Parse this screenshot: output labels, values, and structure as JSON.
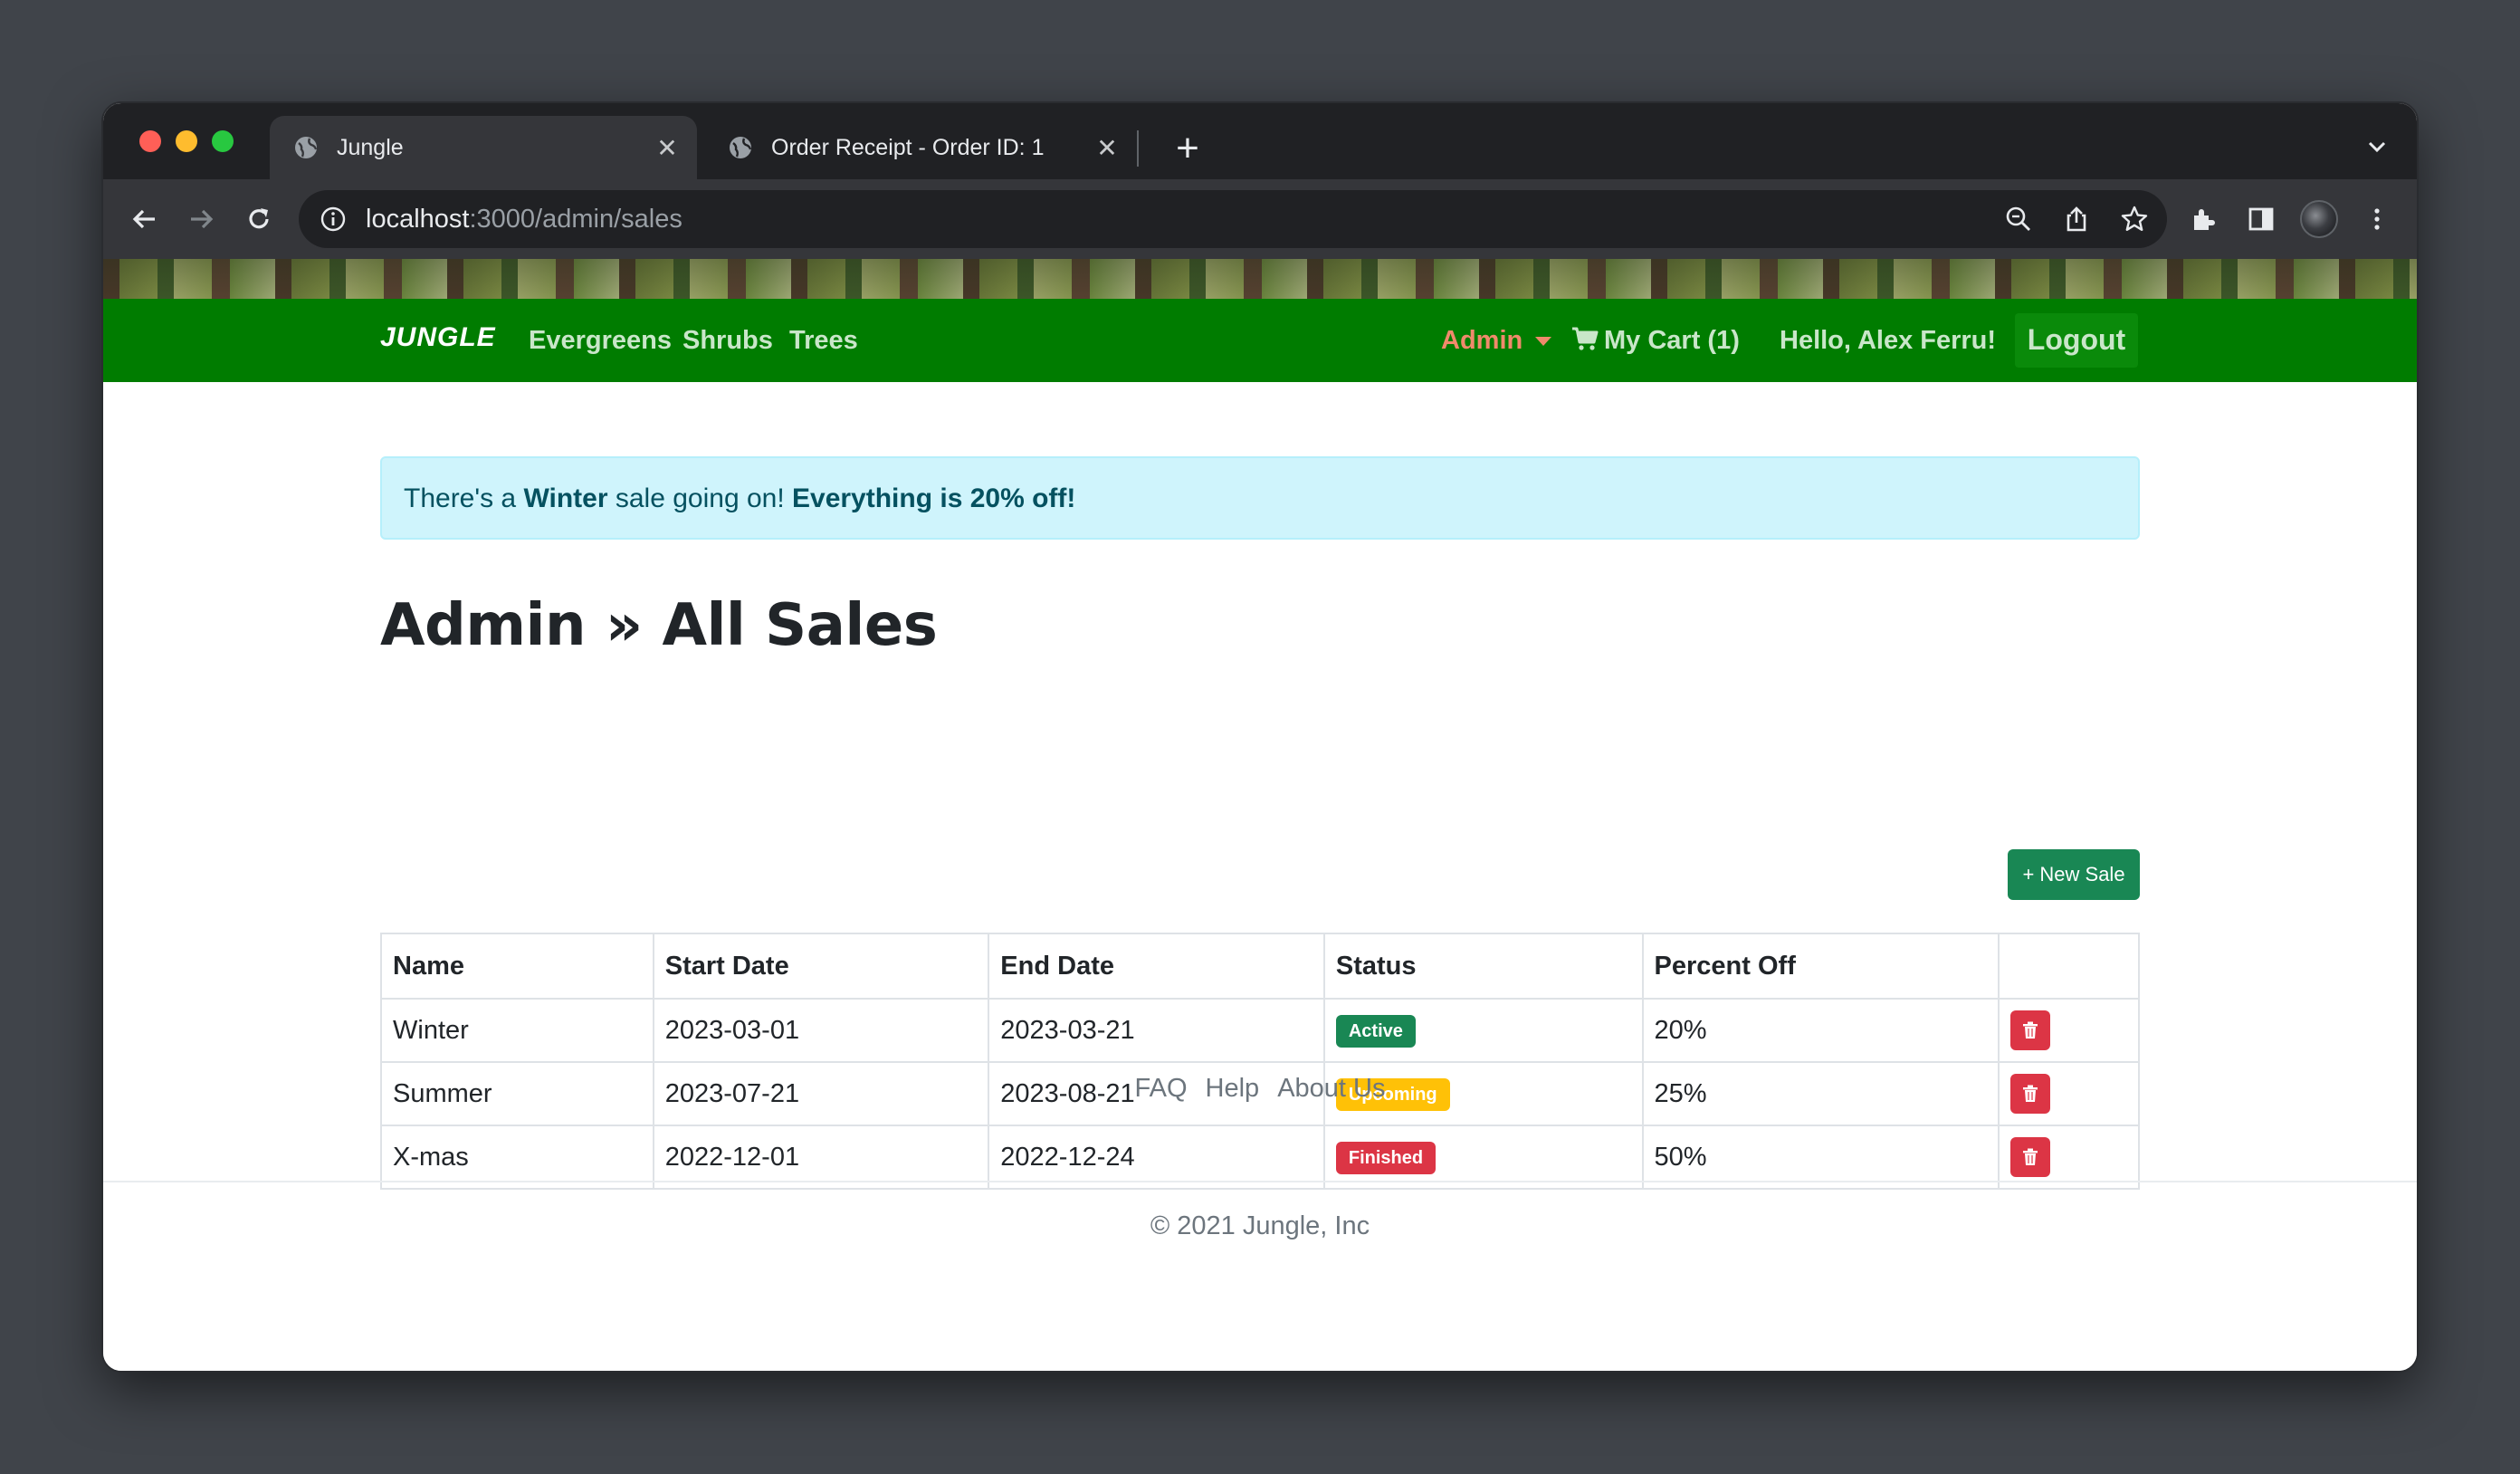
{
  "browser": {
    "tabs": [
      {
        "title": "Jungle",
        "active": true
      },
      {
        "title": "Order Receipt - Order ID: 1",
        "active": false
      }
    ],
    "url_host": "localhost",
    "url_path": ":3000/admin/sales"
  },
  "nav": {
    "brand": "JUNGLE",
    "categories": [
      "Evergreens",
      "Shrubs",
      "Trees"
    ],
    "admin": "Admin",
    "cart": "My Cart (1)",
    "greeting": "Hello, Alex Ferru!",
    "logout": "Logout"
  },
  "alert": {
    "prefix": "There's a ",
    "sale_name": "Winter",
    "middle": " sale going on! ",
    "emphasis": "Everything is 20% off!"
  },
  "page": {
    "title": "Admin » All Sales",
    "new_sale_button": "+ New Sale"
  },
  "table": {
    "headers": [
      "Name",
      "Start Date",
      "End Date",
      "Status",
      "Percent Off",
      ""
    ],
    "rows": [
      {
        "name": "Winter",
        "start": "2023-03-01",
        "end": "2023-03-21",
        "status": "Active",
        "percent": "20%"
      },
      {
        "name": "Summer",
        "start": "2023-07-21",
        "end": "2023-08-21",
        "status": "Upcoming",
        "percent": "25%"
      },
      {
        "name": "X-mas",
        "start": "2022-12-01",
        "end": "2022-12-24",
        "status": "Finished",
        "percent": "50%"
      }
    ]
  },
  "footer": {
    "links": [
      "FAQ",
      "Help",
      "About Us"
    ],
    "copyright": "© 2021 Jungle, Inc"
  },
  "colors": {
    "nav_green": "#007c00",
    "alert_bg": "#cff4fc",
    "success": "#198754",
    "warning": "#ffc107",
    "danger": "#dc3545",
    "admin_link": "#f08a6b"
  },
  "icons": [
    "globe-icon",
    "close-icon",
    "plus-icon",
    "chevron-down-icon",
    "back-arrow-icon",
    "forward-arrow-icon",
    "reload-icon",
    "info-icon",
    "zoom-icon",
    "share-icon",
    "star-icon",
    "extensions-icon",
    "side-panel-icon",
    "avatar",
    "more-icon",
    "cart-icon",
    "trash-icon"
  ]
}
